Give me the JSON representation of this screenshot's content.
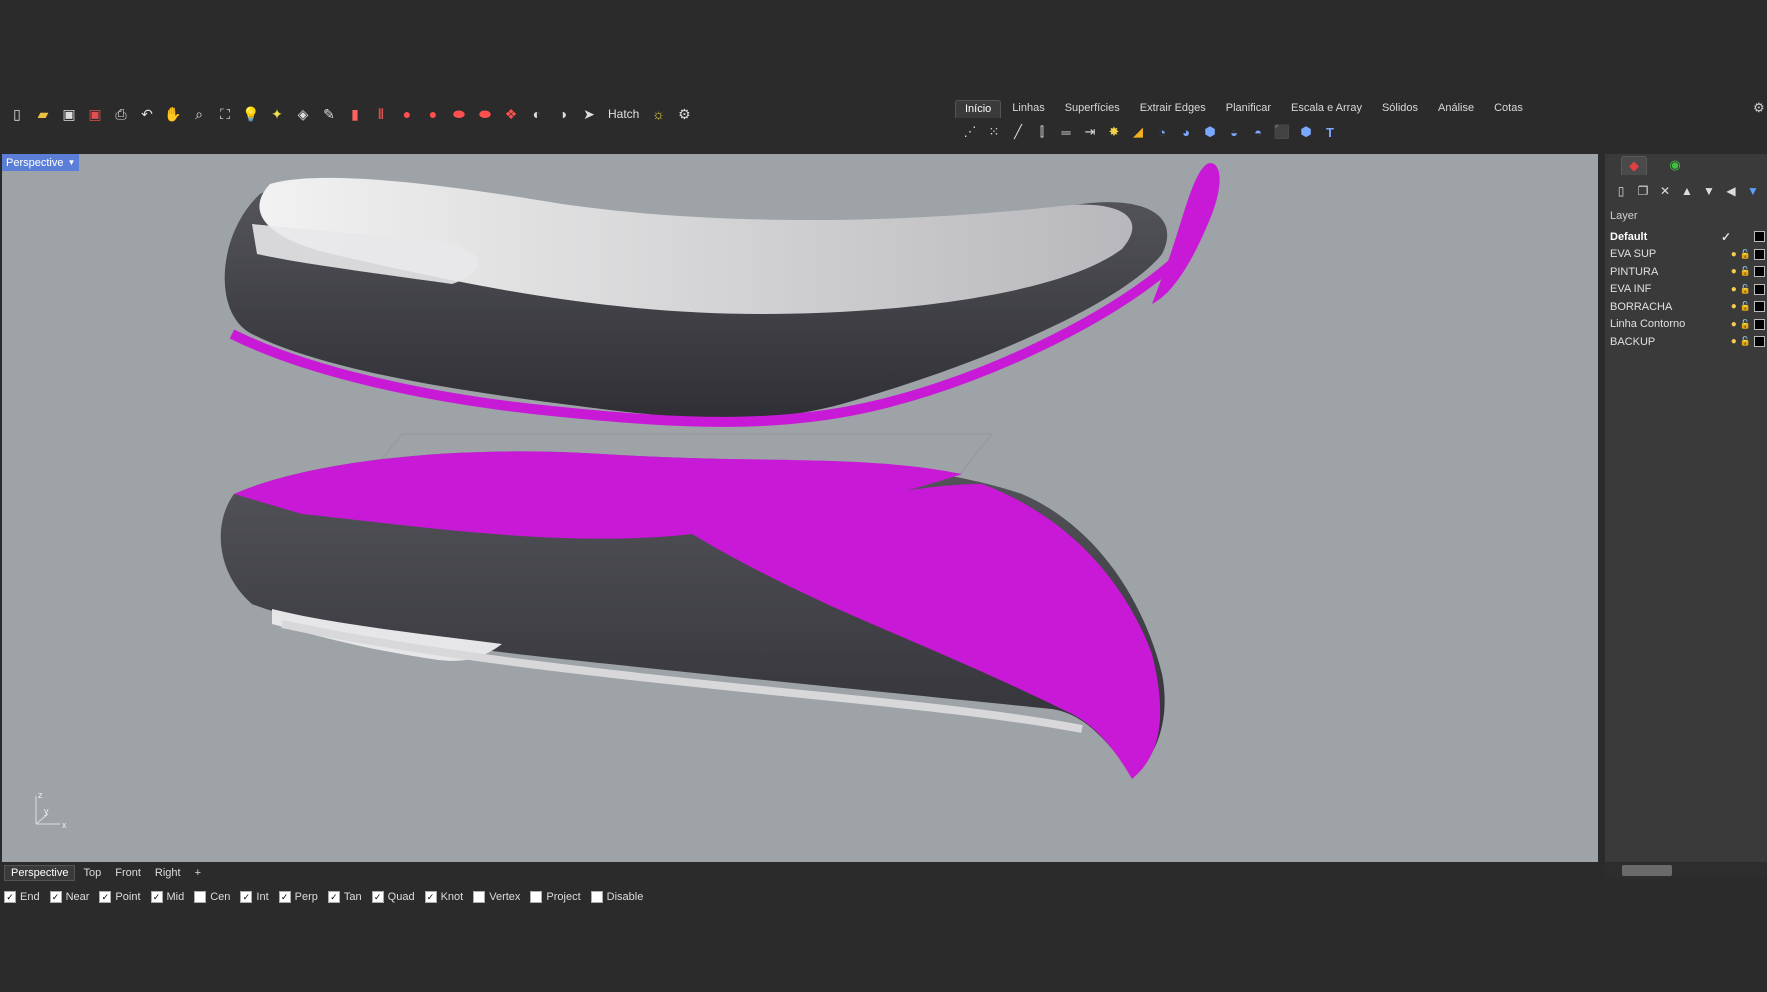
{
  "toolbar": {
    "hatch_label": "Hatch"
  },
  "ribbon_tabs": [
    "Início",
    "Linhas",
    "Superfícies",
    "Extrair Edges",
    "Planificar",
    "Escala e Array",
    "Sólidos",
    "Análise",
    "Cotas"
  ],
  "viewport": {
    "label": "Perspective",
    "axis_z": "z",
    "axis_y": "y",
    "axis_x": "x"
  },
  "viewport_tabs": [
    "Perspective",
    "Top",
    "Front",
    "Right"
  ],
  "add_tab_glyph": "+",
  "layers": {
    "header": "Layer",
    "items": [
      {
        "name": "Default"
      },
      {
        "name": "EVA SUP"
      },
      {
        "name": "PINTURA"
      },
      {
        "name": "EVA INF"
      },
      {
        "name": "BORRACHA"
      },
      {
        "name": "Linha Contorno"
      },
      {
        "name": "BACKUP"
      }
    ]
  },
  "osnaps": [
    {
      "label": "End",
      "checked": true
    },
    {
      "label": "Near",
      "checked": true
    },
    {
      "label": "Point",
      "checked": true
    },
    {
      "label": "Mid",
      "checked": true
    },
    {
      "label": "Cen",
      "checked": false
    },
    {
      "label": "Int",
      "checked": true
    },
    {
      "label": "Perp",
      "checked": true
    },
    {
      "label": "Tan",
      "checked": true
    },
    {
      "label": "Quad",
      "checked": true
    },
    {
      "label": "Knot",
      "checked": true
    },
    {
      "label": "Vertex",
      "checked": false
    },
    {
      "label": "Project",
      "checked": false
    },
    {
      "label": "Disable",
      "checked": false
    }
  ],
  "colors": {
    "viewport_bg": "#9ea3a8",
    "accent_magenta": "#c81ad6",
    "sole_dark": "#3f3f45",
    "sole_light": "#d9dadc",
    "viewport_label": "#5b7fd6"
  }
}
